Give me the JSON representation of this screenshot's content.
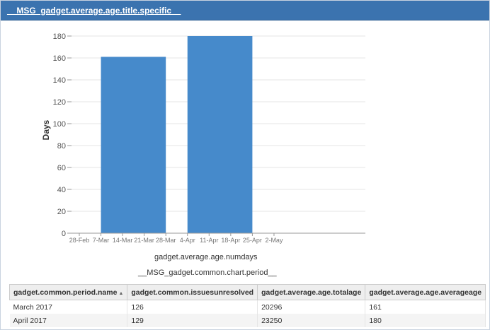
{
  "gadget": {
    "title": "__MSG_gadget.average.age.title.specific__"
  },
  "chart_data": {
    "type": "bar",
    "bars": [
      {
        "x_start": "7-Mar",
        "x_end": "28-Mar",
        "value": 161
      },
      {
        "x_start": "4-Apr",
        "x_end": "25-Apr",
        "value": 180
      }
    ],
    "x_ticks": [
      "28-Feb",
      "7-Mar",
      "14-Mar",
      "21-Mar",
      "28-Mar",
      "4-Apr",
      "11-Apr",
      "18-Apr",
      "25-Apr",
      "2-May"
    ],
    "y_ticks": [
      0,
      20,
      40,
      60,
      80,
      100,
      120,
      140,
      160,
      180
    ],
    "ylim": [
      0,
      180
    ],
    "ylabel": "Days",
    "xlabel": "gadget.average.age.numdays",
    "subcaption": "__MSG_gadget.common.chart.period__",
    "bar_color": "#468acb",
    "grid": true
  },
  "table": {
    "headers": [
      "gadget.common.period.name",
      "gadget.common.issuesunresolved",
      "gadget.average.age.totalage",
      "gadget.average.age.averageage"
    ],
    "sort_indicator": "▲",
    "rows": [
      [
        "March 2017",
        "126",
        "20296",
        "161"
      ],
      [
        "April 2017",
        "129",
        "23250",
        "180"
      ]
    ]
  }
}
